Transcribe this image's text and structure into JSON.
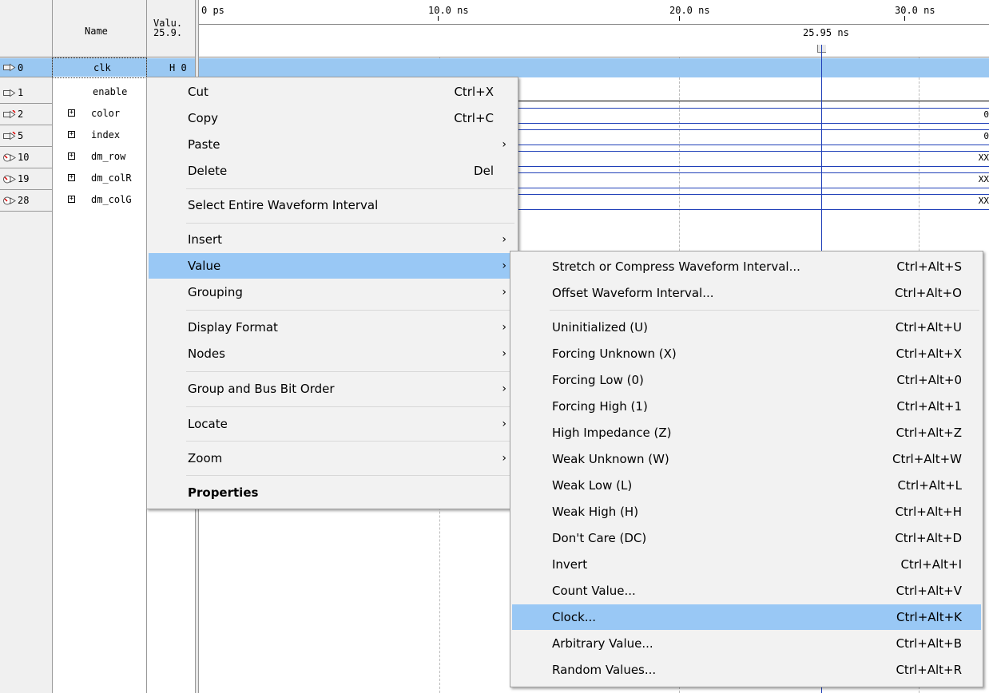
{
  "header": {
    "name_label": "Name",
    "value_label": "Valu.",
    "value_time": "25.9."
  },
  "rows": [
    {
      "id": "0",
      "name": "clk",
      "value": "H 0",
      "expandable": false,
      "icon": "input-pin-icon"
    },
    {
      "id": "1",
      "name": "enable",
      "value": "",
      "expandable": false,
      "icon": "input-pin-icon"
    },
    {
      "id": "2",
      "name": "color",
      "value": "",
      "expandable": true,
      "icon": "input-bus-icon"
    },
    {
      "id": "5",
      "name": "index",
      "value": "",
      "expandable": true,
      "icon": "input-bus-icon"
    },
    {
      "id": "10",
      "name": "dm_row",
      "value": "",
      "expandable": true,
      "icon": "output-bus-icon"
    },
    {
      "id": "19",
      "name": "dm_colR",
      "value": "",
      "expandable": true,
      "icon": "output-bus-icon"
    },
    {
      "id": "28",
      "name": "dm_colG",
      "value": "",
      "expandable": true,
      "icon": "output-bus-icon"
    }
  ],
  "ruler": {
    "ticks": [
      "0 ps",
      "10.0 ns",
      "20.0 ns",
      "30.0 ns"
    ],
    "cursor_label": "25.95 ns"
  },
  "wave_values": {
    "color": "0",
    "index": "0",
    "dm_row": "XX",
    "dm_colR": "XX",
    "dm_colG": "XX"
  },
  "context_menu": {
    "items": [
      {
        "label": "Cut",
        "shortcut": "Ctrl+X"
      },
      {
        "label": "Copy",
        "shortcut": "Ctrl+C"
      },
      {
        "label": "Paste",
        "submenu": true
      },
      {
        "label": "Delete",
        "shortcut": "Del"
      },
      {
        "label": "Select Entire Waveform Interval"
      },
      {
        "label": "Insert",
        "submenu": true
      },
      {
        "label": "Value",
        "submenu": true,
        "highlighted": true
      },
      {
        "label": "Grouping",
        "submenu": true
      },
      {
        "label": "Display Format",
        "submenu": true
      },
      {
        "label": "Nodes",
        "submenu": true
      },
      {
        "label": "Group and Bus Bit Order",
        "submenu": true
      },
      {
        "label": "Locate",
        "submenu": true
      },
      {
        "label": "Zoom",
        "submenu": true
      },
      {
        "label": "Properties",
        "bold": true
      }
    ],
    "arrow": "›"
  },
  "value_submenu": {
    "items": [
      {
        "label": "Stretch or Compress Waveform Interval...",
        "shortcut": "Ctrl+Alt+S"
      },
      {
        "label": "Offset Waveform Interval...",
        "shortcut": "Ctrl+Alt+O"
      },
      {
        "label": "Uninitialized (U)",
        "shortcut": "Ctrl+Alt+U"
      },
      {
        "label": "Forcing Unknown (X)",
        "shortcut": "Ctrl+Alt+X"
      },
      {
        "label": "Forcing Low (0)",
        "shortcut": "Ctrl+Alt+0"
      },
      {
        "label": "Forcing High (1)",
        "shortcut": "Ctrl+Alt+1"
      },
      {
        "label": "High Impedance (Z)",
        "shortcut": "Ctrl+Alt+Z"
      },
      {
        "label": "Weak Unknown (W)",
        "shortcut": "Ctrl+Alt+W"
      },
      {
        "label": "Weak Low (L)",
        "shortcut": "Ctrl+Alt+L"
      },
      {
        "label": "Weak High (H)",
        "shortcut": "Ctrl+Alt+H"
      },
      {
        "label": "Don't Care (DC)",
        "shortcut": "Ctrl+Alt+D"
      },
      {
        "label": "Invert",
        "shortcut": "Ctrl+Alt+I"
      },
      {
        "label": "Count Value...",
        "shortcut": "Ctrl+Alt+V"
      },
      {
        "label": "Clock...",
        "shortcut": "Ctrl+Alt+K",
        "highlighted": true
      },
      {
        "label": "Arbitrary Value...",
        "shortcut": "Ctrl+Alt+B"
      },
      {
        "label": "Random Values...",
        "shortcut": "Ctrl+Alt+R"
      }
    ]
  },
  "colors": {
    "selection": "#9ac8f2",
    "menu_highlight": "#99c8f5",
    "cursor": "#1f3fb8"
  }
}
